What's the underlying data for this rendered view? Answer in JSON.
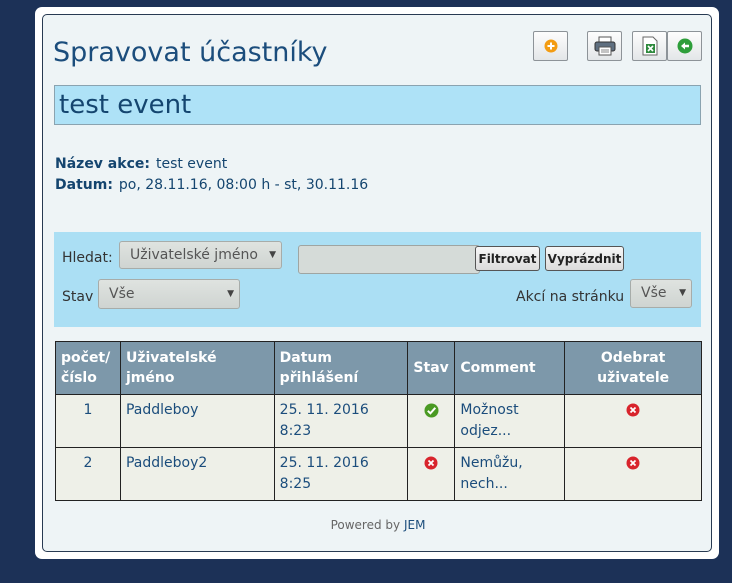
{
  "header": {
    "title": "Spravovat účastníky"
  },
  "toolbar": {
    "add_icon": "add-circle-icon",
    "print_icon": "printer-icon",
    "export_icon": "excel-export-icon",
    "back_icon": "back-arrow-icon"
  },
  "event": {
    "title": "test event",
    "name_label": "Název akce:",
    "name_value": "test event",
    "date_label": "Datum:",
    "date_value": "po, 28.11.16, 08:00 h - st, 30.11.16"
  },
  "filter": {
    "search_label": "Hledat:",
    "search_field_selected": "Uživatelské jméno",
    "search_value": "",
    "filter_button": "Filtrovat",
    "clear_button": "Vyprázdnit",
    "status_label": "Stav",
    "status_selected": "Vše",
    "per_page_label": "Akcí na stránku",
    "per_page_selected": "Vše"
  },
  "table": {
    "headers": {
      "number": "počet/ číslo",
      "username": "Uživatelské jméno",
      "date": "Datum přihlášení",
      "status": "Stav",
      "comment": "Comment",
      "remove": "Odebrat uživatele"
    },
    "rows": [
      {
        "number": "1",
        "username": "Paddleboy",
        "date": "25. 11. 2016 8:23",
        "status": "attending",
        "status_icon": "check-icon",
        "comment": "Možnost odjez...",
        "remove_icon": "remove-icon"
      },
      {
        "number": "2",
        "username": "Paddleboy2",
        "date": "25. 11. 2016 8:25",
        "status": "not-attending",
        "status_icon": "cross-icon",
        "comment": "Nemůžu, nech...",
        "remove_icon": "remove-icon"
      }
    ]
  },
  "footer": {
    "prefix": "Powered by",
    "link": "JEM"
  },
  "colors": {
    "background": "#1c3157",
    "title": "#1b4d7c",
    "event_bar": "#aee2f7",
    "table_header": "#7d98aa",
    "check": "#4a9a23",
    "cross": "#d8242c",
    "add_icon": "#f39c12",
    "back_icon": "#2e9e3a"
  }
}
